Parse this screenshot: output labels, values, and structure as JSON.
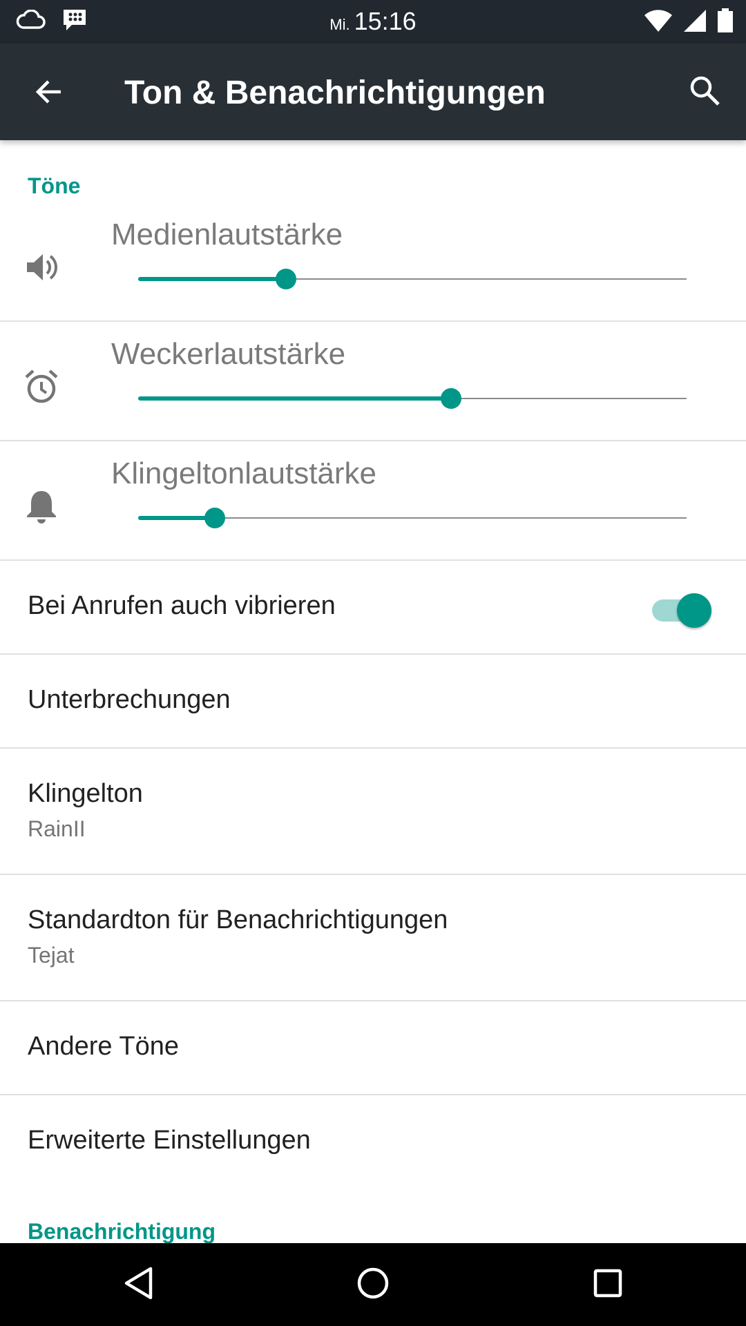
{
  "status_bar": {
    "day": "Mi.",
    "time": "15:16",
    "left_icons": [
      "cloud-icon",
      "blackberry-messenger-icon"
    ],
    "right_icons": [
      "wifi-icon",
      "signal-icon",
      "battery-icon"
    ]
  },
  "app_bar": {
    "title": "Ton & Benachrichtigungen",
    "back_icon": "arrow-back-icon",
    "search_icon": "search-icon"
  },
  "sections": {
    "tones_header": "Töne",
    "notification_header": "Benachrichtigung"
  },
  "sliders": [
    {
      "label": "Medienlautstärke",
      "icon": "volume-icon",
      "level": 0.27
    },
    {
      "label": "Weckerlautstärke",
      "icon": "alarm-icon",
      "level": 0.57
    },
    {
      "label": "Klingeltonlautstärke",
      "icon": "bell-icon",
      "level": 0.14
    }
  ],
  "vibrate": {
    "label": "Bei Anrufen auch vibrieren",
    "enabled": true
  },
  "interruptions": {
    "label": "Unterbrechungen"
  },
  "ringtone": {
    "label": "Klingelton",
    "value": "RainII"
  },
  "notification_sound": {
    "label": "Standardton für Benachrichtigungen",
    "value": "Tejat"
  },
  "other_sounds": {
    "label": "Andere Töne"
  },
  "advanced": {
    "label": "Erweiterte Einstellungen"
  },
  "colors": {
    "accent": "#009688",
    "app_bar": "#283036",
    "status_bar": "#21282f"
  },
  "nav_bar": [
    "back-triangle-icon",
    "home-circle-icon",
    "recents-square-icon"
  ]
}
